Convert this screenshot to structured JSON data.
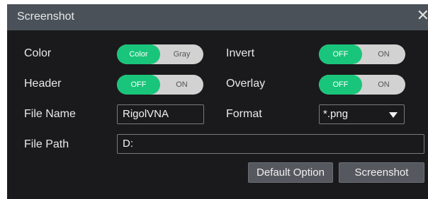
{
  "window": {
    "title": "Screenshot",
    "close_glyph": "✕"
  },
  "fields": {
    "color": {
      "label": "Color",
      "options": [
        "Color",
        "Gray"
      ],
      "selected": "Color"
    },
    "invert": {
      "label": "Invert",
      "options": [
        "OFF",
        "ON"
      ],
      "selected": "OFF"
    },
    "header": {
      "label": "Header",
      "options": [
        "OFF",
        "ON"
      ],
      "selected": "OFF"
    },
    "overlay": {
      "label": "Overlay",
      "options": [
        "OFF",
        "ON"
      ],
      "selected": "OFF"
    },
    "file_name": {
      "label": "File Name",
      "value": "RigolVNA"
    },
    "format": {
      "label": "Format",
      "value": "*.png"
    },
    "file_path": {
      "label": "File Path",
      "value": "D:"
    }
  },
  "buttons": {
    "default_option": "Default Option",
    "screenshot": "Screenshot"
  },
  "colors": {
    "accent": "#19c57a",
    "titlebar": "#4a5159",
    "background": "#1a1a1c"
  }
}
